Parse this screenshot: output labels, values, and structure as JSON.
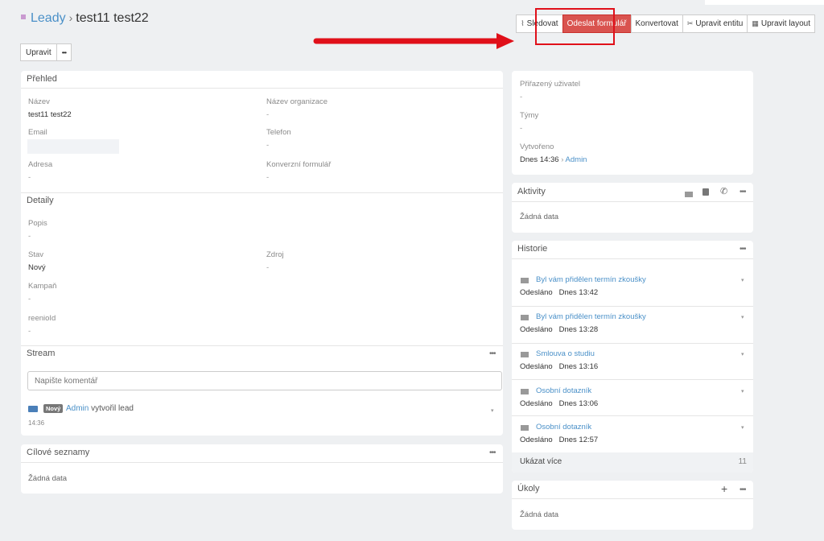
{
  "header": {
    "breadcrumb_link": "Leady",
    "breadcrumb_sep": "›",
    "record_name": "test11 test22",
    "buttons": {
      "follow": "Sledovat",
      "send_form": "Odeslat formulář",
      "convert": "Konvertovat",
      "edit_entity": "Upravit entitu",
      "edit_layout": "Upravit layout"
    }
  },
  "toolbar": {
    "edit": "Upravit",
    "more": "•••"
  },
  "overview": {
    "title": "Přehled",
    "fields": {
      "name_label": "Název",
      "name_value": "test11 test22",
      "org_label": "Název organizace",
      "org_value": "-",
      "email_label": "Email",
      "phone_label": "Telefon",
      "phone_value": "-",
      "address_label": "Adresa",
      "address_value": "-",
      "conv_label": "Konverzní formulář",
      "conv_value": "-"
    }
  },
  "details": {
    "title": "Detaily",
    "desc_label": "Popis",
    "desc_value": "-",
    "status_label": "Stav",
    "status_value": "Nový",
    "source_label": "Zdroj",
    "source_value": "-",
    "campaign_label": "Kampaň",
    "campaign_value": "-",
    "reenio_label": "reenioId",
    "reenio_value": "-"
  },
  "stream": {
    "title": "Stream",
    "placeholder": "Napište komentář",
    "badge": "Nový",
    "user": "Admin",
    "action": "vytvořil lead",
    "time": "14:36"
  },
  "target_lists": {
    "title": "Cílové seznamy",
    "empty": "Žádná data"
  },
  "assign": {
    "assigned_label": "Přiřazený uživatel",
    "assigned_value": "-",
    "teams_label": "Týmy",
    "teams_value": "-",
    "created_label": "Vytvořeno",
    "created_value": "Dnes 14:36",
    "created_sep": "›",
    "created_by": "Admin"
  },
  "activities": {
    "title": "Aktivity",
    "empty": "Žádná data"
  },
  "history": {
    "title": "Historie",
    "items": [
      {
        "subject": "Byl vám přidělen termín zkoušky",
        "status": "Odesláno",
        "time": "Dnes 13:42"
      },
      {
        "subject": "Byl vám přidělen termín zkoušky",
        "status": "Odesláno",
        "time": "Dnes 13:28"
      },
      {
        "subject": "Smlouva o studiu",
        "status": "Odesláno",
        "time": "Dnes 13:16"
      },
      {
        "subject": "Osobní dotazník",
        "status": "Odesláno",
        "time": "Dnes 13:06"
      },
      {
        "subject": "Osobní dotazník",
        "status": "Odesláno",
        "time": "Dnes 12:57"
      }
    ],
    "show_more": "Ukázat více",
    "count": "11"
  },
  "tasks": {
    "title": "Úkoly",
    "empty": "Žádná data",
    "add": "+"
  },
  "colors": {
    "primary": "#d9534f",
    "link": "#4a90c8",
    "highlight": "#e0101a"
  }
}
